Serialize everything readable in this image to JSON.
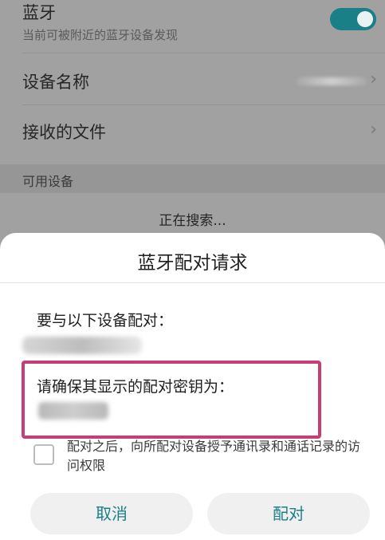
{
  "settings": {
    "bluetooth": {
      "title": "蓝牙",
      "subtitle": "当前可被附近的蓝牙设备发现",
      "enabled": true
    },
    "device_name": {
      "label": "设备名称"
    },
    "received_files": {
      "label": "接收的文件"
    },
    "available_section": {
      "label": "可用设备"
    },
    "searching_text": "正在搜索..."
  },
  "dialog": {
    "title": "蓝牙配对请求",
    "prompt": "要与以下设备配对：",
    "confirm_text": "请确保其显示的配对密钥为：",
    "permission_text": "配对之后，向所配对设备授予通讯录和通话记录的访问权限",
    "permission_checked": false,
    "cancel_label": "取消",
    "pair_label": "配对"
  },
  "colors": {
    "accent": "#1a7f86",
    "highlight": "#c73d78"
  },
  "icons": {
    "chevron": "chevron-right-icon"
  }
}
